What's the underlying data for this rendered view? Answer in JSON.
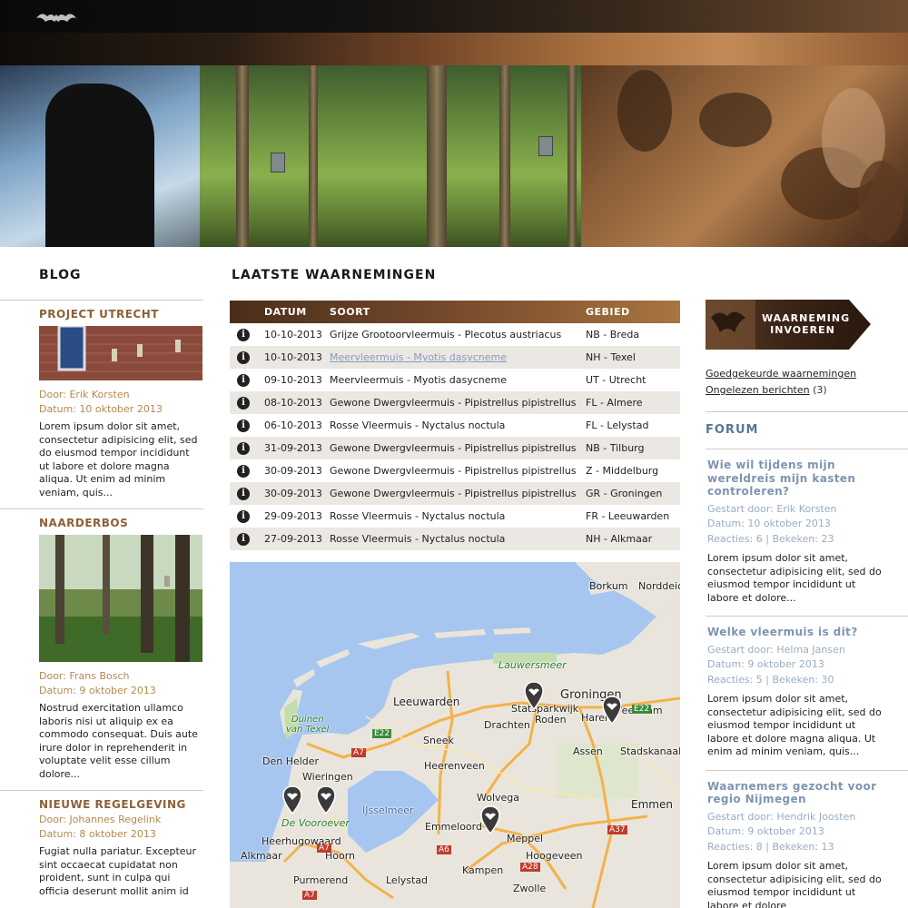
{
  "blog": {
    "title": "BLOG",
    "items": [
      {
        "title": "PROJECT UTRECHT",
        "author": "Door: Erik Korsten",
        "date": "Datum: 10 oktober 2013",
        "excerpt": "Lorem ipsum dolor sit amet, consectetur adipisicing elit, sed do eiusmod tempor incididunt ut labore et dolore magna aliqua. Ut enim ad minim veniam, quis..."
      },
      {
        "title": "NAARDERBOS",
        "author": "Door: Frans Bosch",
        "date": "Datum: 9 oktober 2013",
        "excerpt": "Nostrud exercitation ullamco laboris nisi ut aliquip ex ea commodo consequat. Duis aute irure dolor in reprehenderit in voluptate velit esse cillum dolore..."
      },
      {
        "title": "NIEUWE REGELGEVING",
        "author": "Door: Johannes Regelink",
        "date": "Datum: 8 oktober 2013",
        "excerpt": "Fugiat nulla pariatur. Excepteur sint occaecat cupidatat non proident, sunt in culpa qui officia deserunt mollit anim id"
      }
    ]
  },
  "observations": {
    "title": "LAATSTE WAARNEMINGEN",
    "columns": {
      "datum": "DATUM",
      "soort": "SOORT",
      "gebied": "GEBIED"
    },
    "info_glyph": "i",
    "rows": [
      {
        "datum": "10-10-2013",
        "soort": "Grijze Grootoorvleermuis - Plecotus austriacus",
        "gebied": "NB - Breda"
      },
      {
        "datum": "10-10-2013",
        "soort": "Meervleermuis - Myotis dasycneme",
        "gebied": "NH - Texel"
      },
      {
        "datum": "09-10-2013",
        "soort": "Meervleermuis - Myotis dasycneme",
        "gebied": "UT - Utrecht"
      },
      {
        "datum": "08-10-2013",
        "soort": "Gewone Dwergvleermuis - Pipistrellus pipistrellus",
        "gebied": "FL - Almere"
      },
      {
        "datum": "06-10-2013",
        "soort": "Rosse Vleermuis - Nyctalus noctula",
        "gebied": "FL - Lelystad"
      },
      {
        "datum": "31-09-2013",
        "soort": "Gewone Dwergvleermuis - Pipistrellus pipistrellus",
        "gebied": "NB - Tilburg"
      },
      {
        "datum": "30-09-2013",
        "soort": "Gewone Dwergvleermuis - Pipistrellus pipistrellus",
        "gebied": "Z - Middelburg"
      },
      {
        "datum": "30-09-2013",
        "soort": "Gewone Dwergvleermuis - Pipistrellus pipistrellus",
        "gebied": "GR - Groningen"
      },
      {
        "datum": "29-09-2013",
        "soort": "Rosse Vleermuis - Nyctalus noctula",
        "gebied": "FR - Leeuwarden"
      },
      {
        "datum": "27-09-2013",
        "soort": "Rosse Vleermuis - Nyctalus noctula",
        "gebied": "NH - Alkmaar"
      }
    ]
  },
  "map": {
    "labels": {
      "borkum": "Borkum",
      "norddeich": "Norddeich",
      "lauwersmeer": "Lauwersmeer",
      "groningen": "Groningen",
      "leeuwarden": "Leeuwarden",
      "stadskanaal": "Stadskanaal",
      "veendam": "Veendam",
      "haren": "Haren",
      "roden": "Roden",
      "drachten": "Drachten",
      "surhuisterveen": "Statsparkwijk",
      "sneek": "Sneek",
      "heerenveen": "Heerenveen",
      "assen": "Assen",
      "duinen_van_texel": "Duinen\nvan Texel",
      "den_helder": "Den Helder",
      "wieringen": "Wieringen",
      "ijsselmeer": "IJsselmeer",
      "de_vooroever": "De Vooroever",
      "heerhugowaard": "Heerhugowaard",
      "hoorn": "Hoorn",
      "alkmaar": "Alkmaar",
      "purmerend": "Purmerend",
      "lelystad": "Lelystad",
      "emmeloord": "Emmeloord",
      "wolvega": "Wolvega",
      "meppel": "Meppel",
      "hoogeveen": "Hoogeveen",
      "kampen": "Kampen",
      "zwolle": "Zwolle",
      "emmen": "Emmen"
    },
    "roads": {
      "a7_1": "A7",
      "a7_2": "A7",
      "a7_3": "A7",
      "e22_1": "E22",
      "e22_2": "E22",
      "a6": "A6",
      "a28": "A28",
      "a37": "A37"
    }
  },
  "sidebar": {
    "cta_label": "WAARNEMING INVOEREN",
    "links": [
      {
        "label": "Goedgekeurde waarnemingen",
        "suffix": ""
      },
      {
        "label": "Ongelezen berichten",
        "suffix": " (3)"
      }
    ]
  },
  "forum": {
    "title": "FORUM",
    "items": [
      {
        "title": "Wie wil tijdens mijn wereldreis mijn kasten controleren?",
        "starter": "Gestart door: Erik Korsten",
        "date": "Datum: 10 oktober 2013",
        "stats": "Reacties: 6 | Bekeken: 23",
        "excerpt": "Lorem ipsum dolor sit amet, consectetur adipisicing elit, sed do eiusmod tempor incididunt ut labore et dolore..."
      },
      {
        "title": "Welke vleermuis is dit?",
        "starter": "Gestart door: Helma Jansen",
        "date": "Datum: 9 oktober 2013",
        "stats": "Reacties: 5 | Bekeken: 30",
        "excerpt": "Lorem ipsum dolor sit amet, consectetur adipisicing elit, sed do eiusmod tempor incididunt ut labore et dolore magna aliqua. Ut enim ad minim veniam, quis..."
      },
      {
        "title": "Waarnemers gezocht voor regio Nijmegen",
        "starter": "Gestart door: Hendrik Joosten",
        "date": "Datum: 9 oktober 2013",
        "stats": "Reacties: 8 | Bekeken: 13",
        "excerpt": "Lorem ipsum dolor sit amet, consectetur adipisicing elit, sed do eiusmod tempor incididunt ut labore et dolore"
      }
    ]
  }
}
